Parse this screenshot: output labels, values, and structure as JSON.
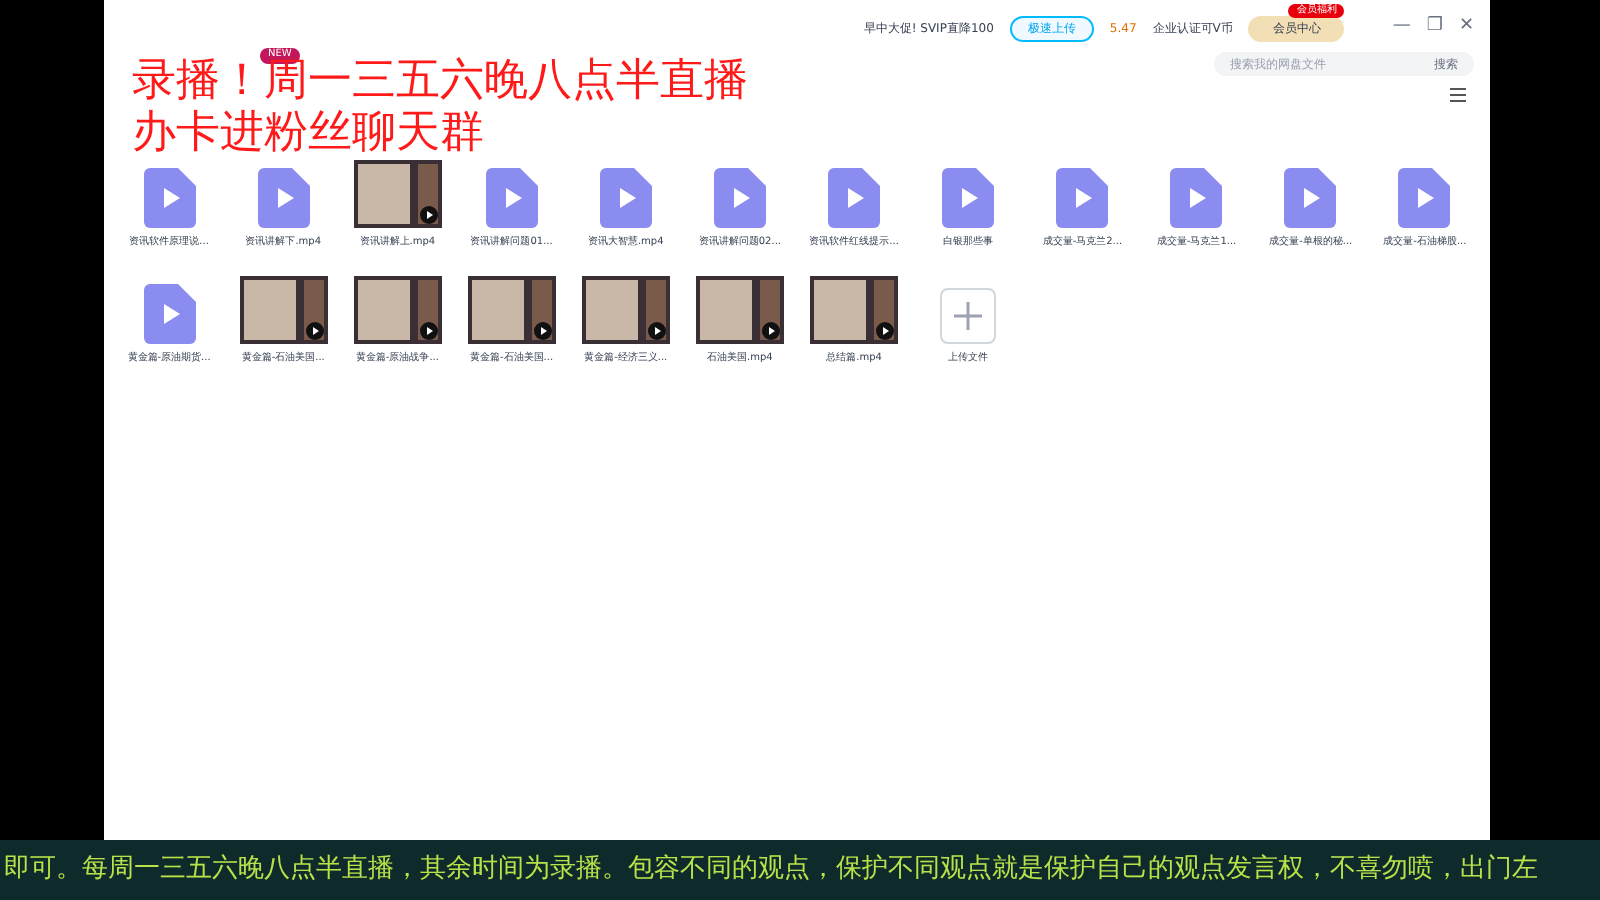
{
  "topbar": {
    "promo": "早中大促! SVIP直降100",
    "upload_speed": "极速上传",
    "coupon": "5.47",
    "vip_badge": "会员福利",
    "vip_link": "企业认证可V币",
    "member_center": "会员中心"
  },
  "toolbar": {
    "badge": "NEW"
  },
  "window_controls": [
    "—",
    "❐",
    "✕"
  ],
  "search": {
    "placeholder": "搜索我的网盘文件",
    "button": "搜索"
  },
  "files": [
    {
      "kind": "video",
      "name": "资讯软件原理说..."
    },
    {
      "kind": "video",
      "name": "资讯讲解下.mp4"
    },
    {
      "kind": "thumb",
      "name": "资讯讲解上.mp4"
    },
    {
      "kind": "video",
      "name": "资讯讲解问题01..."
    },
    {
      "kind": "video",
      "name": "资讯大智慧.mp4"
    },
    {
      "kind": "video",
      "name": "资讯讲解问题02..."
    },
    {
      "kind": "video",
      "name": "资讯软件红线提示..."
    },
    {
      "kind": "video",
      "name": "白银那些事"
    },
    {
      "kind": "video",
      "name": "成交量-马克兰2..."
    },
    {
      "kind": "video",
      "name": "成交量-马克兰1..."
    },
    {
      "kind": "video",
      "name": "成交量-单根的秘..."
    },
    {
      "kind": "video",
      "name": "成交量-石油梯股..."
    },
    {
      "kind": "video",
      "name": "黄金篇-原油期货..."
    },
    {
      "kind": "thumb",
      "name": "黄金篇-石油美国..."
    },
    {
      "kind": "thumb",
      "name": "黄金篇-原油战争..."
    },
    {
      "kind": "thumb",
      "name": "黄金篇-石油美国..."
    },
    {
      "kind": "thumb",
      "name": "黄金篇-经济三义..."
    },
    {
      "kind": "thumb",
      "name": "石油美国.mp4"
    },
    {
      "kind": "thumb",
      "name": "总结篇.mp4"
    },
    {
      "kind": "upload",
      "name": "上传文件"
    }
  ],
  "overlay": [
    "录播！周一三五六晚八点半直播",
    "办卡进粉丝聊天群"
  ],
  "ticker": "即可。每周一三五六晚八点半直播，其余时间为录播。包容不同的观点，保护不同观点就是保护自己的观点发言权，不喜勿喷，出门左"
}
